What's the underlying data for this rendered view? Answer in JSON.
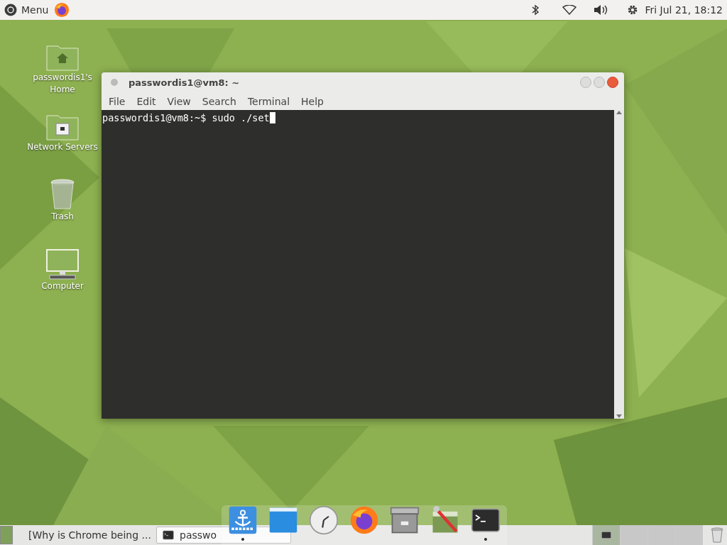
{
  "top_panel": {
    "menu_label": "Menu",
    "clock": "Fri Jul 21, 18:12"
  },
  "desktop_icons": [
    {
      "kind": "home",
      "label": "passwordis1's Home"
    },
    {
      "kind": "network",
      "label": "Network Servers"
    },
    {
      "kind": "trash",
      "label": "Trash"
    },
    {
      "kind": "computer",
      "label": "Computer"
    }
  ],
  "terminal": {
    "title": "passwordis1@vm8: ~",
    "menu": [
      "File",
      "Edit",
      "View",
      "Search",
      "Terminal",
      "Help"
    ],
    "prompt": "passwordis1@vm8:~$ sudo ./set"
  },
  "taskbar": [
    {
      "kind": "browser",
      "label": "[Why is Chrome being ...",
      "selected": false
    },
    {
      "kind": "terminal",
      "label": "passwo",
      "selected": true
    }
  ],
  "workspaces": [
    {
      "selected": true
    },
    {
      "selected": false
    },
    {
      "selected": false
    },
    {
      "selected": false
    }
  ],
  "dock": [
    {
      "kind": "anchor",
      "running": true
    },
    {
      "kind": "window",
      "running": false
    },
    {
      "kind": "clock",
      "running": false
    },
    {
      "kind": "firefox",
      "running": false
    },
    {
      "kind": "cabinet",
      "running": false
    },
    {
      "kind": "tools",
      "running": false
    },
    {
      "kind": "terminal",
      "running": true
    }
  ]
}
